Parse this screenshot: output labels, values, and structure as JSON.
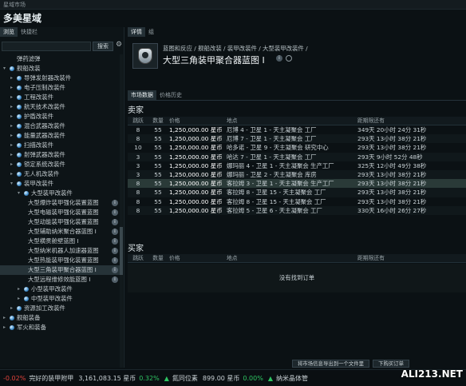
{
  "window": {
    "title": "星域市场",
    "app_title": "多美星域"
  },
  "left": {
    "tabs": [
      "浏览",
      "快捷栏"
    ],
    "search_button": "搜索",
    "tree": [
      {
        "label": "弹药滤弹",
        "indent": 2,
        "arrow": "",
        "gem": false
      },
      {
        "label": "舰船改装",
        "indent": 1,
        "arrow": "▾",
        "gem": true
      },
      {
        "label": "导弹发射器改装件",
        "indent": 2,
        "arrow": "▸",
        "gem": true
      },
      {
        "label": "电子压制改装件",
        "indent": 2,
        "arrow": "▸",
        "gem": true
      },
      {
        "label": "工程改装件",
        "indent": 2,
        "arrow": "▸",
        "gem": true
      },
      {
        "label": "航天技术改装件",
        "indent": 2,
        "arrow": "▸",
        "gem": true
      },
      {
        "label": "护盾改装件",
        "indent": 2,
        "arrow": "▸",
        "gem": true
      },
      {
        "label": "混合武器改装件",
        "indent": 2,
        "arrow": "▸",
        "gem": true
      },
      {
        "label": "能量武器改装件",
        "indent": 2,
        "arrow": "▸",
        "gem": true
      },
      {
        "label": "扫描改装件",
        "indent": 2,
        "arrow": "▸",
        "gem": true
      },
      {
        "label": "射弹武器改装件",
        "indent": 2,
        "arrow": "▸",
        "gem": true
      },
      {
        "label": "锁定系统改装件",
        "indent": 2,
        "arrow": "▸",
        "gem": true
      },
      {
        "label": "无人机改装件",
        "indent": 2,
        "arrow": "▸",
        "gem": true
      },
      {
        "label": "装甲改装件",
        "indent": 2,
        "arrow": "▾",
        "gem": true
      },
      {
        "label": "大型装甲改装件",
        "indent": 3,
        "arrow": "▾",
        "gem": true
      },
      {
        "label": "大型爆炸装甲强化装置蓝图",
        "indent": 4,
        "arrow": "",
        "gem": false,
        "info": true
      },
      {
        "label": "大型电磁装甲强化装置蓝图",
        "indent": 4,
        "arrow": "",
        "gem": false,
        "info": true
      },
      {
        "label": "大型动能装甲强化装置蓝图",
        "indent": 4,
        "arrow": "",
        "gem": false,
        "info": true
      },
      {
        "label": "大型辅助纳米聚合器蓝图 I",
        "indent": 4,
        "arrow": "",
        "gem": false,
        "info": true
      },
      {
        "label": "大型横贯舱壁蓝图 I",
        "indent": 4,
        "arrow": "",
        "gem": false,
        "info": true
      },
      {
        "label": "大型纳米机器人加速器蓝图",
        "indent": 4,
        "arrow": "",
        "gem": false,
        "info": true
      },
      {
        "label": "大型热能装甲强化装置蓝图",
        "indent": 4,
        "arrow": "",
        "gem": false,
        "info": true
      },
      {
        "label": "大型三角装甲聚合器蓝图 I",
        "indent": 4,
        "arrow": "",
        "gem": false,
        "info": true,
        "selected": true
      },
      {
        "label": "大型远程维修效能蓝图 I",
        "indent": 4,
        "arrow": "",
        "gem": false,
        "info": true
      },
      {
        "label": "小型装甲改装件",
        "indent": 3,
        "arrow": "▸",
        "gem": true
      },
      {
        "label": "中型装甲改装件",
        "indent": 3,
        "arrow": "▸",
        "gem": true
      },
      {
        "label": "资源加工改装件",
        "indent": 2,
        "arrow": "▸",
        "gem": true
      },
      {
        "label": "舰船装备",
        "indent": 1,
        "arrow": "▸",
        "gem": true
      },
      {
        "label": "军火和装备",
        "indent": 1,
        "arrow": "▸",
        "gem": true
      }
    ]
  },
  "right": {
    "tabs": [
      "详情",
      "组"
    ],
    "breadcrumb": "蓝图和反应 / 舰船改装 / 装甲改装件 / 大型装甲改装件 /",
    "item_title": "大型三角装甲聚合器蓝图 I",
    "sub_tabs": [
      "市场数据",
      "价格历史"
    ],
    "sellers_title": "卖家",
    "buyers_title": "买家",
    "columns": {
      "jumps": "跳跃",
      "qty": "数量",
      "price": "价格",
      "location": "地点",
      "expires": "距期限还有"
    },
    "sellers": [
      {
        "jumps": "8",
        "qty": "55",
        "price": "1,250,000.00 星币",
        "location": "厄博 4 - 卫星 1 - 天主凝聚会 工厂",
        "expires": "349天 20小时 24分 31秒"
      },
      {
        "jumps": "8",
        "qty": "55",
        "price": "1,250,000.00 星币",
        "location": "厄博 7 - 卫星 1 - 天主凝聚会 工厂",
        "expires": "293天 13小时 38分 21秒"
      },
      {
        "jumps": "10",
        "qty": "55",
        "price": "1,250,000.00 星币",
        "location": "哈多诺 - 卫星 9 - 天主凝聚会 研究中心",
        "expires": "293天 13小时 38分 21秒"
      },
      {
        "jumps": "3",
        "qty": "55",
        "price": "1,250,000.00 星币",
        "location": "哈达 7 - 卫星 1 - 天主凝聚会 工厂",
        "expires": "293天 9小时 52分 48秒"
      },
      {
        "jumps": "3",
        "qty": "55",
        "price": "1,250,000.00 星币",
        "location": "娜玛丽 4 - 卫星 1 - 天主凝聚会 生产工厂",
        "expires": "325天 12小时 49分 38秒"
      },
      {
        "jumps": "3",
        "qty": "55",
        "price": "1,250,000.00 星币",
        "location": "娜玛丽 - 卫星 2 - 天主凝聚会 库房",
        "expires": "293天 13小时 38分 21秒"
      },
      {
        "jumps": "8",
        "qty": "55",
        "price": "1,250,000.00 星币",
        "location": "客拉姆 3 - 卫星 1 - 天主凝聚会 生产工厂",
        "expires": "293天 13小时 38分 21秒",
        "highlight": true
      },
      {
        "jumps": "8",
        "qty": "55",
        "price": "1,250,000.00 星币",
        "location": "客拉姆 8 - 卫星 15 - 天主凝聚会 工厂",
        "expires": "293天 13小时 38分 21秒"
      },
      {
        "jumps": "8",
        "qty": "55",
        "price": "1,250,000.00 星币",
        "location": "客拉姆 8 - 卫星 15 - 天主凝聚会 工厂",
        "expires": "293天 13小时 38分 21秒"
      },
      {
        "jumps": "8",
        "qty": "55",
        "price": "1,250,000.00 星币",
        "location": "客拉姆 5 - 卫星 6 - 天主凝聚会 工厂",
        "expires": "330天 16小时 26分 27秒"
      }
    ],
    "no_orders": "没有找到订单",
    "btn_export": "将市场信息导出到一个文件里",
    "btn_buy": "下购买订单"
  },
  "ticker": {
    "items": [
      {
        "change": "-0.02%",
        "sign": "neg",
        "arrow": "",
        "name": "",
        "price": ""
      },
      {
        "change": "",
        "sign": "",
        "arrow": "",
        "name": "完好的装甲附甲",
        "price": "3,161,083.15 星币"
      },
      {
        "change": "0.32%",
        "sign": "pos",
        "arrow": "▲",
        "name": "氮同位素",
        "price": "899.00 星币"
      },
      {
        "change": "0.00%",
        "sign": "pos",
        "arrow": "▲",
        "name": "纳米晶体管",
        "price": ""
      }
    ]
  },
  "watermark": "ALI213.NET"
}
